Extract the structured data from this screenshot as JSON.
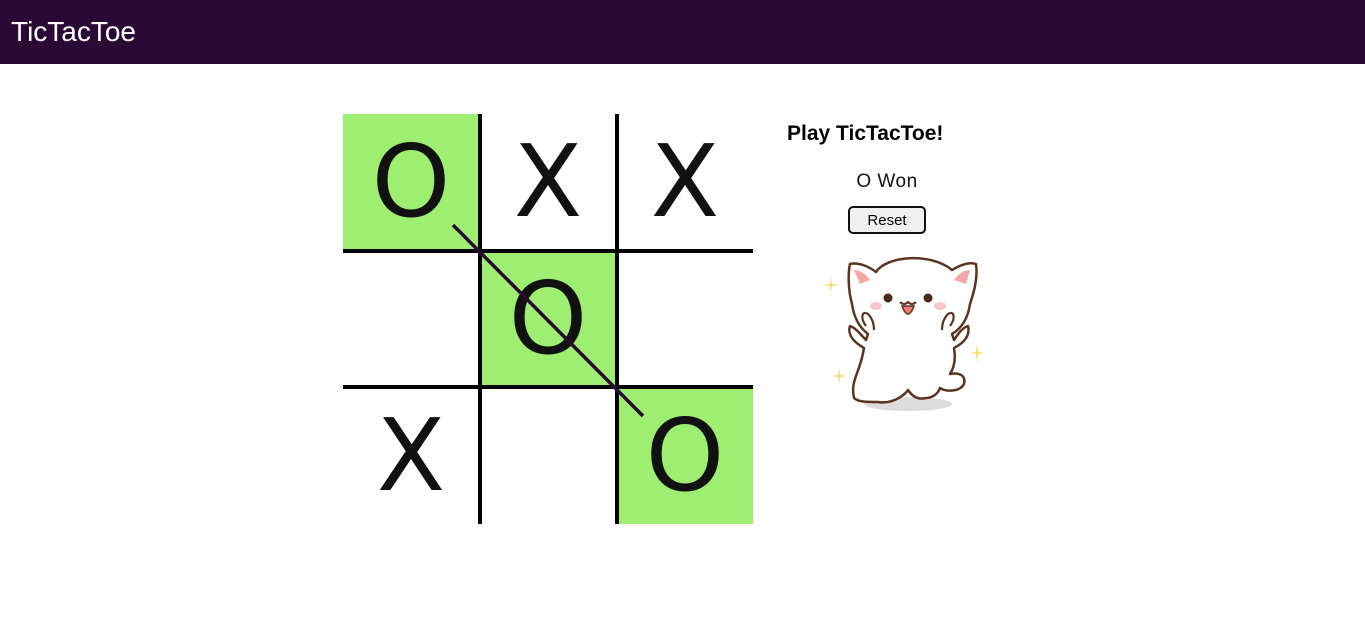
{
  "app": {
    "title": "TicTacToe"
  },
  "board": {
    "cells": [
      "O",
      "X",
      "X",
      "",
      "O",
      "",
      "X",
      "",
      "O"
    ],
    "winning_cells": [
      0,
      4,
      8
    ],
    "colors": {
      "win_cell": "#9eee72",
      "grid": "#000000",
      "win_line": "#2a0a35"
    }
  },
  "side": {
    "title": "Play TicTacToe!",
    "status": "O Won",
    "reset_label": "Reset"
  },
  "sticker": {
    "name": "cheering-cat"
  },
  "colors": {
    "navbar": "#2a0a35"
  }
}
